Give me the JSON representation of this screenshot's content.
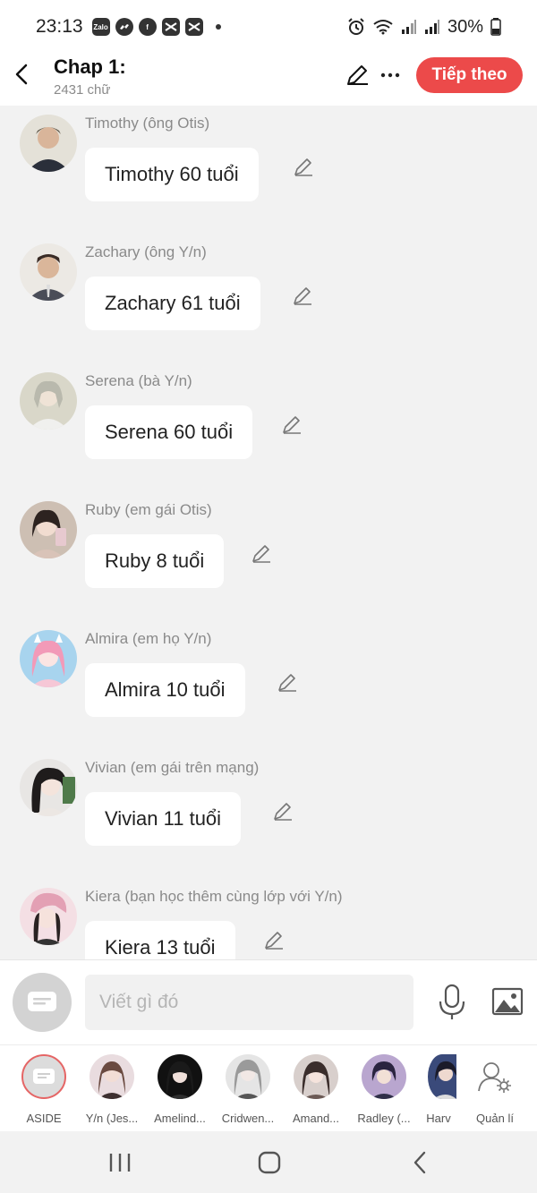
{
  "status_bar": {
    "time": "23:13",
    "battery": "30%",
    "apps": [
      "Zalo",
      "Messenger",
      "Facebook",
      "CapCut",
      "CapCut"
    ]
  },
  "header": {
    "title": "Chap 1:",
    "word_count": "2431 chữ",
    "next_label": "Tiếp theo"
  },
  "messages": [
    {
      "sender": "Timothy (ông Otis)",
      "text": "Timothy 60 tuổi",
      "avatar_color": "#6b6b5e"
    },
    {
      "sender": "Zachary (ông Y/n)",
      "text": "Zachary 61 tuổi",
      "avatar_color": "#5a4a44"
    },
    {
      "sender": "Serena (bà Y/n)",
      "text": "Serena 60 tuổi",
      "avatar_color": "#c9c6b5"
    },
    {
      "sender": "Ruby (em gái Otis)",
      "text": "Ruby 8 tuổi",
      "avatar_color": "#b9a69a"
    },
    {
      "sender": "Almira (em họ Y/n)",
      "text": "Almira 10 tuổi",
      "avatar_color": "#f29ab8"
    },
    {
      "sender": "Vivian (em gái trên mạng)",
      "text": "Vivian 11 tuổi",
      "avatar_color": "#4a4a4a"
    },
    {
      "sender": "Kiera (bạn học thêm cùng lớp với Y/n)",
      "text": "Kiera 13 tuổi",
      "avatar_color": "#e2a3b0"
    }
  ],
  "composer": {
    "placeholder": "Viết gì đó"
  },
  "characters": [
    {
      "label": "ASIDE"
    },
    {
      "label": "Y/n (Jes...",
      "color": "#8a6a60"
    },
    {
      "label": "Amelind...",
      "color": "#1e1e1e"
    },
    {
      "label": "Cridwen...",
      "color": "#a6a6a6"
    },
    {
      "label": "Amand...",
      "color": "#5a4a48"
    },
    {
      "label": "Radley (...",
      "color": "#7a6aa0"
    },
    {
      "label": "Harv",
      "color": "#3a4a7a"
    },
    {
      "label": "Quản lí"
    }
  ],
  "colors": {
    "accent": "#ec4a4a",
    "background": "#f2f2f2",
    "bubble": "#ffffff"
  }
}
